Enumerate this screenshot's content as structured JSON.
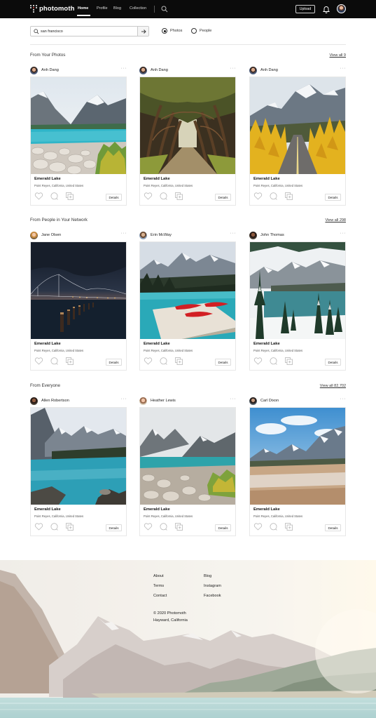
{
  "nav": {
    "brand": "photomoth",
    "links": [
      {
        "label": "Home",
        "active": true
      },
      {
        "label": "Profile",
        "active": false
      },
      {
        "label": "Blog",
        "active": false
      },
      {
        "label": "Collection",
        "active": false
      }
    ],
    "upload_label": "Upload"
  },
  "search": {
    "value": "san francisco",
    "options": [
      {
        "label": "Photos",
        "selected": true
      },
      {
        "label": "People",
        "selected": false
      }
    ]
  },
  "sections": [
    {
      "title": "From Your Photos",
      "view_all": "View all 9",
      "cards": [
        {
          "user": "Anh Dang",
          "title": "Emerald Lake",
          "location": "Point Reyes, California, United States",
          "details_label": "Details",
          "photo": "lake-rocks"
        },
        {
          "user": "Anh Dang",
          "title": "Emerald Lake",
          "location": "Point Reyes, California, United States",
          "details_label": "Details",
          "photo": "tree-tunnel"
        },
        {
          "user": "Anh Dang",
          "title": "Emerald Lake",
          "location": "Point Reyes, California, United States",
          "details_label": "Details",
          "photo": "autumn-road"
        }
      ]
    },
    {
      "title": "From People in Your Network",
      "view_all": "View all 298",
      "cards": [
        {
          "user": "Jane Olsen",
          "title": "Emerald Lake",
          "location": "Point Reyes, California, United States",
          "details_label": "Details",
          "photo": "bay-bridge"
        },
        {
          "user": "Erin McWay",
          "title": "Emerald Lake",
          "location": "Point Reyes, California, United States",
          "details_label": "Details",
          "photo": "red-canoes"
        },
        {
          "user": "John Thomas",
          "title": "Emerald Lake",
          "location": "Point Reyes, California, United States",
          "details_label": "Details",
          "photo": "snowy-lake"
        }
      ]
    },
    {
      "title": "From Everyone",
      "view_all": "View all 82,702",
      "cards": [
        {
          "user": "Allen Robertson",
          "title": "Emerald Lake",
          "location": "Point Reyes, California, United States",
          "details_label": "Details",
          "photo": "blue-lake"
        },
        {
          "user": "Heather Lewis",
          "title": "Emerald Lake",
          "location": "Point Reyes, California, United States",
          "details_label": "Details",
          "photo": "misty-lake"
        },
        {
          "user": "Carl Dixon",
          "title": "Emerald Lake",
          "location": "Point Reyes, California, United States",
          "details_label": "Details",
          "photo": "meadow-peaks"
        }
      ]
    }
  ],
  "footer": {
    "col1": [
      "About",
      "Terms",
      "Contact"
    ],
    "col2": [
      "Blog",
      "Instagram",
      "Facebook"
    ],
    "copyright": "© 2020 Photomoth",
    "address": "Hayward, California"
  },
  "icons": {
    "card_actions": [
      "heart-icon",
      "comment-icon",
      "add-to-collection-icon"
    ],
    "more": "more-icon"
  }
}
